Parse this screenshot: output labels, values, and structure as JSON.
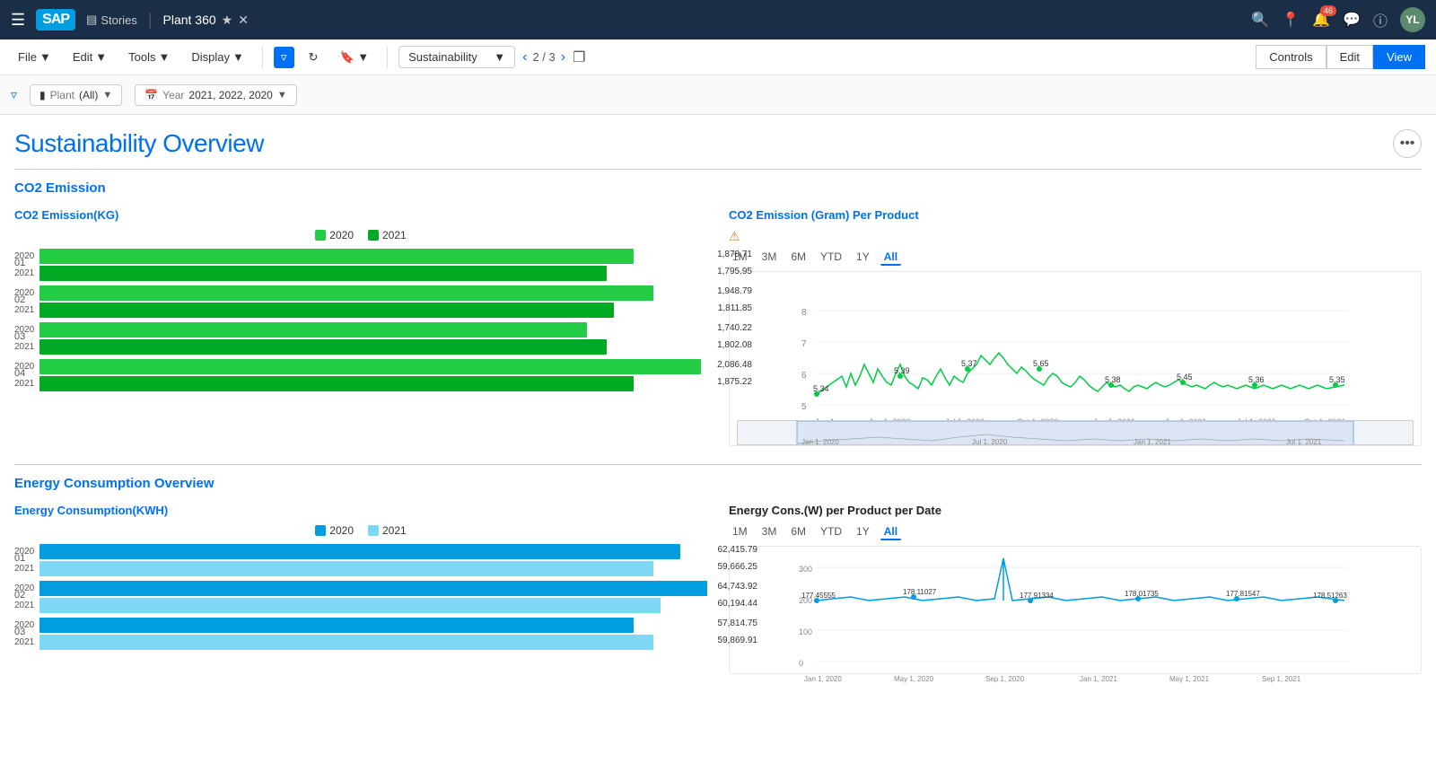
{
  "nav": {
    "logo": "SAP",
    "stories_label": "Stories",
    "plant_title": "Plant 360",
    "notif_count": "46",
    "avatar_initials": "YL",
    "nav_items": [
      "hamburger",
      "stories",
      "separator",
      "plant360",
      "star",
      "close"
    ]
  },
  "toolbar": {
    "file_label": "File",
    "edit_label": "Edit",
    "tools_label": "Tools",
    "display_label": "Display",
    "dropdown_value": "Sustainability",
    "page_info": "2 / 3",
    "controls_label": "Controls",
    "edit_btn": "Edit",
    "view_btn": "View"
  },
  "filter_bar": {
    "plant_label": "Plant",
    "plant_value": "(All)",
    "year_label": "Year",
    "year_value": "2021, 2022, 2020"
  },
  "page": {
    "title": "Sustainability Overview",
    "more_options": "•••"
  },
  "co2_section": {
    "section_title": "CO2 Emission",
    "left_chart_title": "CO2 Emission(KG)",
    "legend_2020": "2020",
    "legend_2021": "2021",
    "color_2020": "#22cc44",
    "color_2021": "#00aa22",
    "bar_data": [
      {
        "group": "01",
        "year": "2020",
        "value": 1878.71,
        "pct": 89
      },
      {
        "group": "01",
        "year": "2021",
        "value": 1795.95,
        "pct": 85
      },
      {
        "group": "02",
        "year": "2020",
        "value": 1948.79,
        "pct": 92
      },
      {
        "group": "02",
        "year": "2021",
        "value": 1811.85,
        "pct": 86
      },
      {
        "group": "03",
        "year": "2020",
        "value": 1740.22,
        "pct": 82
      },
      {
        "group": "03",
        "year": "2021",
        "value": 1802.08,
        "pct": 85
      },
      {
        "group": "04",
        "year": "2020",
        "value": 2086.48,
        "pct": 99
      },
      {
        "group": "04",
        "year": "2021",
        "value": 1875.22,
        "pct": 89
      }
    ],
    "right_chart_title": "CO2 Emission (Gram) Per Product",
    "time_filters": [
      "1M",
      "3M",
      "6M",
      "YTD",
      "1Y",
      "All"
    ],
    "active_filter": "All",
    "x_labels": [
      "Jan 1,...",
      "Apr 1, 2020",
      "Jul 1, 2020",
      "Oct 1, 2020",
      "Jan 1, 2021",
      "Apr 1, 2021",
      "Jul 1, 2021",
      "Oct 1, 2021"
    ],
    "y_labels": [
      "5",
      "6",
      "7",
      "8"
    ],
    "data_points": [
      {
        "x": 5,
        "y": 5.34,
        "label": "5.34"
      },
      {
        "x": 13,
        "y": 5.39,
        "label": "5.39"
      },
      {
        "x": 19,
        "y": 5.37,
        "label": "5.37"
      },
      {
        "x": 33,
        "y": 5.65,
        "label": "5.65"
      },
      {
        "x": 54,
        "y": 5.38,
        "label": "5.38"
      },
      {
        "x": 66,
        "y": 5.45,
        "label": "5.45"
      },
      {
        "x": 78,
        "y": 5.36,
        "label": "5.36"
      },
      {
        "x": 93,
        "y": 5.35,
        "label": "5.35"
      }
    ]
  },
  "energy_section": {
    "section_title": "Energy Consumption Overview",
    "left_chart_title": "Energy Consumption(KWH)",
    "legend_2020": "2020",
    "legend_2021": "2021",
    "color_2020": "#009de0",
    "color_2021": "#7dd8f5",
    "bar_data": [
      {
        "group": "01",
        "year": "2020",
        "value": 62415.79,
        "pct": 96
      },
      {
        "group": "01",
        "year": "2021",
        "value": 59666.25,
        "pct": 92
      },
      {
        "group": "02",
        "year": "2020",
        "value": 64743.92,
        "pct": 100
      },
      {
        "group": "02",
        "year": "2021",
        "value": 60194.44,
        "pct": 93
      },
      {
        "group": "03",
        "year": "2020",
        "value": 57814.75,
        "pct": 89
      },
      {
        "group": "03",
        "year": "2021",
        "value": 59869.91,
        "pct": 92
      }
    ],
    "right_chart_title": "Energy Cons.(W) per Product per Date",
    "time_filters": [
      "1M",
      "3M",
      "6M",
      "YTD",
      "1Y",
      "All"
    ],
    "active_filter": "All",
    "x_labels": [
      "Jan 1, 2020",
      "May 1, 2020",
      "Sep 1, 2020",
      "Jan 1, 2021",
      "May 1, 2021",
      "Sep 1, 2021"
    ],
    "y_labels": [
      "0",
      "100",
      "200",
      "300"
    ],
    "data_points": [
      {
        "x": 3,
        "y": 177.45555,
        "label": "177.45555"
      },
      {
        "x": 18,
        "y": 178.11027,
        "label": "178.11027"
      },
      {
        "x": 38,
        "y": 177.91334,
        "label": "177.91334"
      },
      {
        "x": 55,
        "y": 178.01735,
        "label": "178.01735"
      },
      {
        "x": 72,
        "y": 177.81547,
        "label": "177.81547"
      },
      {
        "x": 90,
        "y": 178.51263,
        "label": "178.51263"
      }
    ]
  }
}
